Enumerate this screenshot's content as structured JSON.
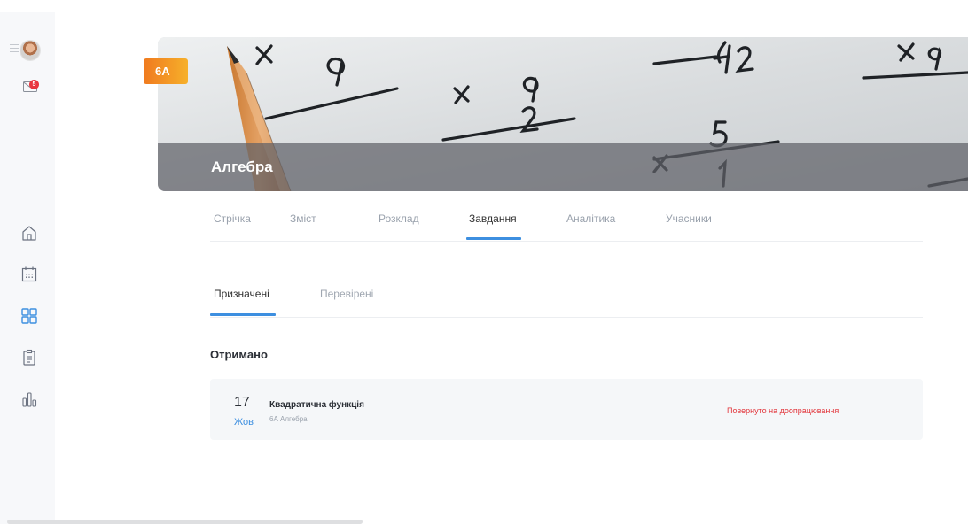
{
  "sidebar": {
    "mail_badge": "5",
    "nav_icons": [
      "home-icon",
      "calendar-icon",
      "grid-icon",
      "clipboard-icon",
      "bar-chart-icon"
    ]
  },
  "course": {
    "class_badge": "6A",
    "title": "Алгебра"
  },
  "tabs": [
    {
      "label": "Стрічка"
    },
    {
      "label": "Зміст"
    },
    {
      "label": "Розклад"
    },
    {
      "label": "Завдання",
      "active": true
    },
    {
      "label": "Аналітика"
    },
    {
      "label": "Учасники"
    }
  ],
  "subtabs": [
    {
      "label": "Призначені",
      "active": true
    },
    {
      "label": "Перевірені"
    }
  ],
  "section_title": "Отримано",
  "task": {
    "day": "17",
    "month": "Жов",
    "name": "Квадратична функція",
    "subtitle": "6А Алгебра",
    "status": "Повернуто на доопрацювання"
  },
  "colors": {
    "accent": "#3d8fe0",
    "status_red": "#e2343a",
    "badge_orange": "#f07a1f"
  }
}
